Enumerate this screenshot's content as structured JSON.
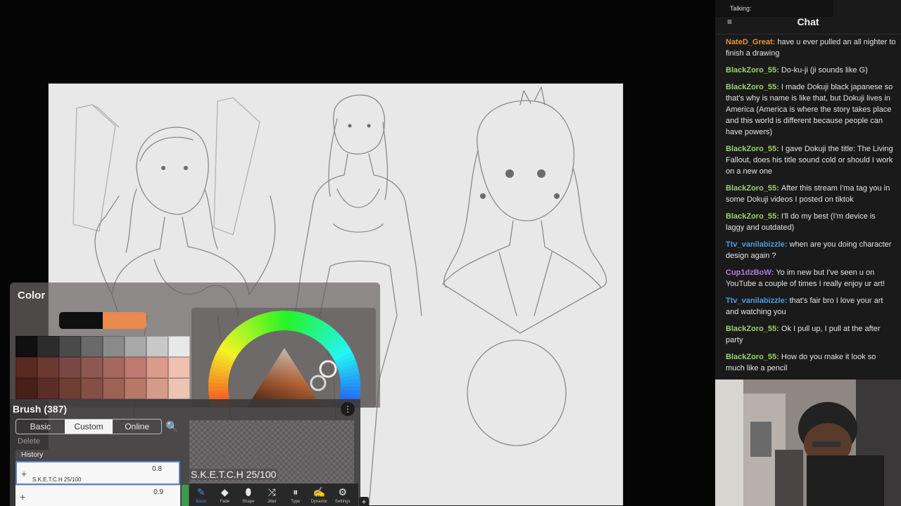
{
  "color_panel": {
    "title": "Color",
    "previous_color": "#0f0f0f",
    "current_color": "#ea8a4c",
    "palette": [
      "#101010",
      "#2c2c2c",
      "#4a4a4a",
      "#6a6a6a",
      "#8a8a8a",
      "#a8a8a8",
      "#c8c8c8",
      "#e8e8e8",
      "#5a2a22",
      "#6a3a32",
      "#7a4842",
      "#8e5852",
      "#a4685f",
      "#c07a70",
      "#dc9a8a",
      "#f0c0b0",
      "#4a1f18",
      "#5a2e26",
      "#6e3e34",
      "#845046",
      "#9c6256",
      "#b87868",
      "#d49a8a",
      "#ecc4b4"
    ]
  },
  "brush_panel": {
    "title": "Brush (387)",
    "tabs": [
      "Basic",
      "Custom",
      "Online"
    ],
    "active_tab": "Custom",
    "delete_label": "Delete",
    "history_label": "History",
    "rows": [
      {
        "value": "0.8",
        "name": "S.K.E.T.C.H 25/100"
      },
      {
        "value": "0.9",
        "name": ""
      }
    ],
    "preview_label": "S.K.E.T.C.H 25/100"
  },
  "toolbar": {
    "tools": [
      {
        "icon": "pen-icon",
        "glyph": "✎",
        "label": "Basic"
      },
      {
        "icon": "fade-icon",
        "glyph": "◆",
        "label": "Fade"
      },
      {
        "icon": "shape-icon",
        "glyph": "⬮",
        "label": "Shape"
      },
      {
        "icon": "jitter-icon",
        "glyph": "⤨",
        "label": "Jitter"
      },
      {
        "icon": "type-icon",
        "glyph": "⏸",
        "label": "Type"
      },
      {
        "icon": "dynamic-icon",
        "glyph": "✍",
        "label": "Dynamic"
      },
      {
        "icon": "settings-icon",
        "glyph": "⚙",
        "label": "Settings"
      }
    ],
    "active_tool": "Basic"
  },
  "chat": {
    "talking_label": "Talking:",
    "title": "Chat",
    "messages": [
      {
        "user": "NateD_Great",
        "color": "#e8913a",
        "text": "have u ever pulled an all nighter to finish a drawing"
      },
      {
        "user": "BlackZoro_55",
        "color": "#9bd36b",
        "text": "Do-ku-ji (ji sounds like G)"
      },
      {
        "user": "BlackZoro_55",
        "color": "#9bd36b",
        "text": "I made Dokuji black japanese so that's why is name is like that, but Dokuji lives in America (America is where the story takes place and this world is different because people can have powers)"
      },
      {
        "user": "BlackZoro_55",
        "color": "#9bd36b",
        "text": "I gave Dokuji the title: The Living Fallout, does his title sound cold or should I work on a new one"
      },
      {
        "user": "BlackZoro_55",
        "color": "#9bd36b",
        "text": "After this stream I'ma tag you in some Dokuji videos I posted on tiktok"
      },
      {
        "user": "BlackZoro_55",
        "color": "#9bd36b",
        "text": "I'll do my best (I'm device is laggy and outdated)"
      },
      {
        "user": "Ttv_vanilabizzle",
        "color": "#4a9ee0",
        "text": "when are you doing character design again ?"
      },
      {
        "user": "Cup1dzBoW",
        "color": "#b57bdc",
        "text": "Yo im new but I've seen u on YouTube a couple of times I really enjoy ur art!"
      },
      {
        "user": "Ttv_vanilabizzle",
        "color": "#4a9ee0",
        "text": "that's fair bro I love your art and watching you"
      },
      {
        "user": "BlackZoro_55",
        "color": "#9bd36b",
        "text": "Ok I pull up, I pull at the after party"
      },
      {
        "user": "BlackZoro_55",
        "color": "#9bd36b",
        "text": "How do you make it look so much like a pencil"
      }
    ]
  }
}
